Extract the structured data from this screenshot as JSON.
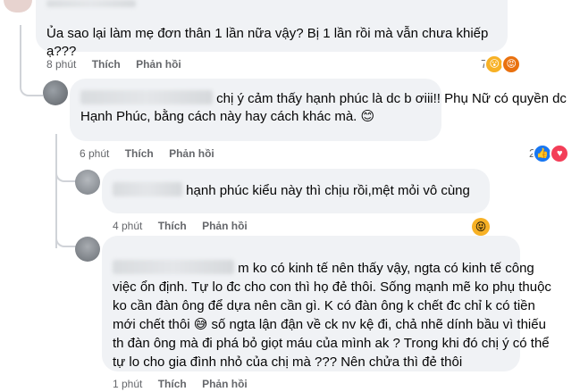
{
  "comments": [
    {
      "text": "Ủa sao lại làm mẹ đơn thân 1 lần nữa vậy? Bị 1 lần rồi mà vẫn chưa khiếp ạ???",
      "time": "8 phút",
      "like": "Thích",
      "reply": "Phản hồi",
      "reaction_count": "7",
      "reactions": [
        "wow-icon",
        "angry-icon"
      ]
    },
    {
      "line1": "chị ý cảm thấy hạnh phúc là dc b ơiii!! Phụ Nữ có quyền dc",
      "line2": "Hạnh Phúc, bằng cách này hay cách khác mà. 😊",
      "time": "6 phút",
      "like": "Thích",
      "reply": "Phản hồi",
      "reaction_count": "2",
      "reactions": [
        "like-icon",
        "love-icon"
      ]
    },
    {
      "text": "hạnh phúc kiểu này thì chịu rồi,mệt mỏi vô cùng",
      "time": "4 phút",
      "like": "Thích",
      "reply": "Phản hồi",
      "reactions": [
        "haha-icon"
      ]
    },
    {
      "line1": "m ko có kinh tế nên thấy vậy, ngta có kinh tế công",
      "line2": "việc ổn định. Tự lo đc cho con thì họ đẻ thôi. Sống mạnh mẽ ko phụ thuộc",
      "line3": "ko cần đàn ông để dựa nên cần gì. K có đàn ông k chết đc chỉ k có tiền",
      "line4": "mới chết thôi 😅 số ngta lận đận về ck nv kệ đi, chả nhẽ dính bầu vì thiếu",
      "line5": "th đàn ông mà đi phá bỏ giọt máu của mình ak ? Trong khi đó chị ý có thể",
      "line6": "tự lo cho gia đình nhỏ của chị mà ??? Nên chửa thì đẻ thôi",
      "time": "1 phút",
      "like": "Thích",
      "reply": "Phản hồi"
    }
  ],
  "colors": {
    "bubble": "#f0f2f5",
    "meta": "#65676b",
    "text": "#050505",
    "line": "#d0d3d8"
  }
}
